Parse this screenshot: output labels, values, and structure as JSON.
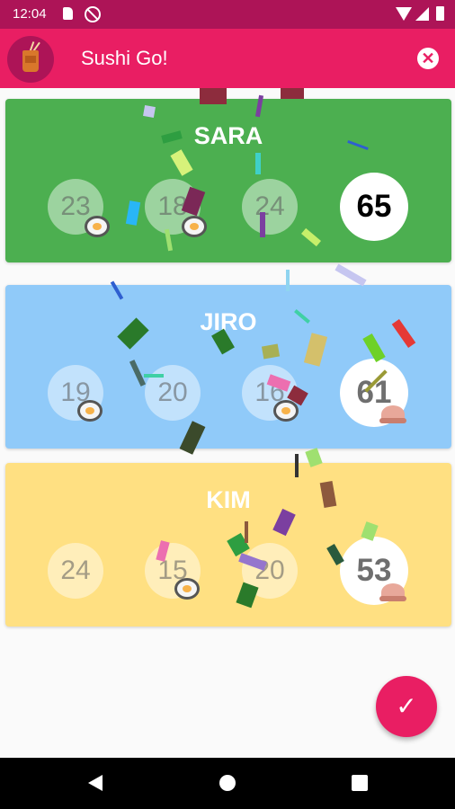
{
  "status_bar": {
    "time": "12:04",
    "icons": [
      "sd-card-icon",
      "do-not-disturb-icon",
      "wifi-icon",
      "signal-icon",
      "battery-icon"
    ]
  },
  "app_bar": {
    "title": "Sushi Go!",
    "logo_icon": "sushi-go-cup-logo-icon",
    "close_icon": "close-circle-icon",
    "background_color": "#e91e63"
  },
  "players": [
    {
      "name": "SARA",
      "rounds": [
        "23",
        "18",
        "24"
      ],
      "total": "65",
      "color": "#4caf50",
      "total_badge": ""
    },
    {
      "name": "JIRO",
      "rounds": [
        "19",
        "20",
        "16"
      ],
      "total": "61",
      "color": "#90caf9",
      "total_badge": "pudding-icon"
    },
    {
      "name": "KIM",
      "rounds": [
        "24",
        "15",
        "20"
      ],
      "total": "53",
      "color": "#ffe082",
      "total_badge": "pudding-icon"
    }
  ],
  "fab": {
    "icon": "checkmark-icon",
    "color": "#e91e63"
  },
  "navigation": {
    "icons": [
      "back-icon",
      "home-icon",
      "recents-icon"
    ]
  }
}
